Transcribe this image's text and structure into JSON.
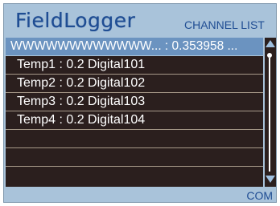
{
  "header": {
    "logo_text": "FieldLogger",
    "title": "CHANNEL LIST"
  },
  "channel_list": {
    "selected_row": "WWWWWWWWWWWW... : 0.353958 ...",
    "rows": [
      "Temp1 : 0.2  Digital101",
      "Temp2 : 0.2  Digital102",
      "Temp3 : 0.2  Digital103",
      "Temp4 : 0.2  Digital104"
    ]
  },
  "footer": {
    "status": "COM"
  },
  "colors": {
    "brand_blue": "#1f4d93",
    "panel_bg": "#a9c3da",
    "list_bg": "#2b1f1e",
    "selection": "#6b93c0"
  },
  "icons": {
    "scroll_up": "triangle-up-icon",
    "scroll_down": "triangle-down-icon"
  }
}
